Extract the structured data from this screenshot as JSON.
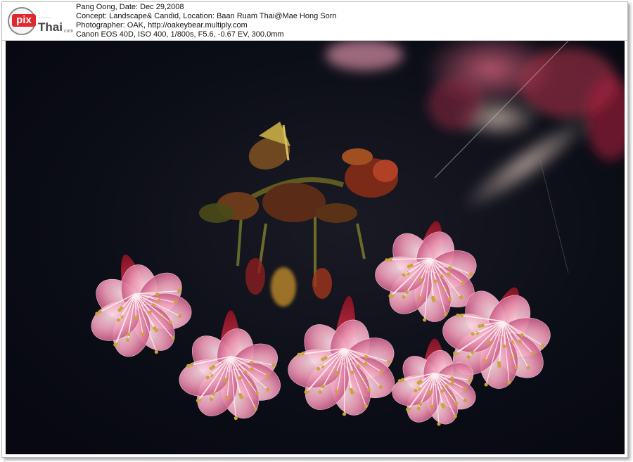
{
  "header": {
    "logo": {
      "word_pix": "pix",
      "word_thai": "Thai",
      "suffix": ".com"
    },
    "lines": [
      "Pang Oong, Date: Dec 29,2008",
      "Concept: Landscape& Candid, Location: Baan Ruam Thai@Mae Hong Sorn",
      "Photographer: OAK, http://oakeybear.multiply.com",
      "Canon EOS 40D, ISO 400, 1/800s, F5.6, -0.67 EV, 300.0mm"
    ]
  },
  "photo": {
    "subject": "pink-cherry-blossoms-icon",
    "colors": {
      "background": "#0b0d14",
      "petal": "#e88aa8",
      "petal_light": "#f6c9d8",
      "stamen": "#c9a43a",
      "sepal": "#a8182a",
      "stem": "#6b6a2a"
    }
  }
}
